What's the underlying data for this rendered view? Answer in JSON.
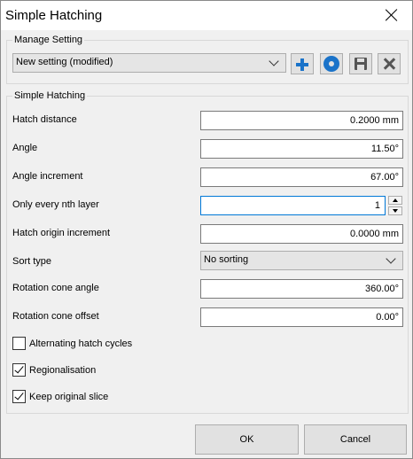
{
  "window": {
    "title": "Simple Hatching"
  },
  "manage": {
    "group_title": "Manage Setting",
    "selected": "New setting (modified)",
    "buttons": {
      "add_icon": "plus-icon",
      "settings_icon": "gear-icon",
      "save_icon": "floppy-disk-icon",
      "delete_icon": "delete-x-icon"
    }
  },
  "hatching": {
    "group_title": "Simple Hatching",
    "fields": [
      {
        "label": "Hatch distance",
        "value": "0.2000 mm"
      },
      {
        "label": "Angle",
        "value": "11.50°"
      },
      {
        "label": "Angle increment",
        "value": "67.00°"
      },
      {
        "label": "Only every nth layer",
        "value": "1"
      },
      {
        "label": "Hatch origin increment",
        "value": "0.0000 mm"
      },
      {
        "label": "Sort type",
        "value": "No sorting"
      },
      {
        "label": "Rotation cone angle",
        "value": "360.00°"
      },
      {
        "label": "Rotation cone offset",
        "value": "0.00°"
      }
    ],
    "checkboxes": [
      {
        "label": "Alternating hatch cycles",
        "checked": false
      },
      {
        "label": "Regionalisation",
        "checked": true
      },
      {
        "label": "Keep original slice",
        "checked": true
      }
    ]
  },
  "footer": {
    "ok_label": "OK",
    "cancel_label": "Cancel"
  },
  "colors": {
    "accent": "#1a73c9",
    "focus_border": "#0078d7",
    "dialog_bg": "#f0f0f0"
  }
}
